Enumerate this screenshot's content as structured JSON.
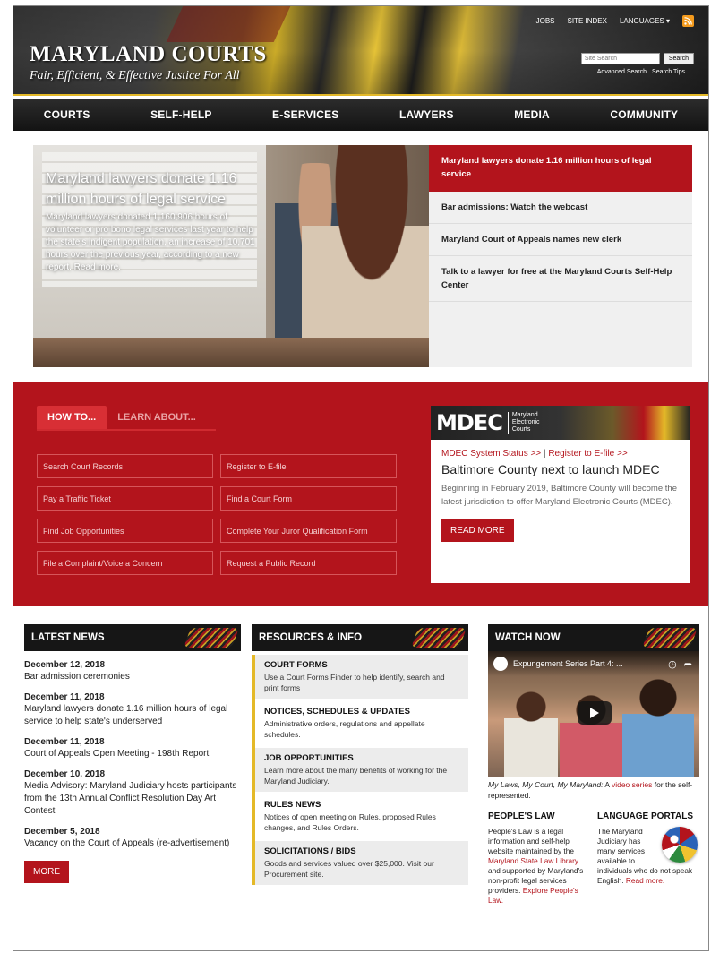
{
  "header": {
    "brand_title": "MARYLAND COURTS",
    "brand_tagline": "Fair, Efficient, & Effective Justice For All",
    "util_links": [
      "JOBS",
      "SITE INDEX",
      "LANGUAGES"
    ],
    "search_placeholder": "Site Search",
    "search_button": "Search",
    "advanced_search": "Advanced Search",
    "search_tips": "Search Tips"
  },
  "nav": [
    "COURTS",
    "SELF-HELP",
    "E-SERVICES",
    "LAWYERS",
    "MEDIA",
    "COMMUNITY"
  ],
  "hero": {
    "title": "Maryland lawyers donate 1.16 million hours of legal service",
    "body": "Maryland lawyers donated 1,160,906 hours of volunteer or pro bono legal services last year to help the state's indigent population, an increase of 10,701 hours over the previous year, according to a new report. Read more.",
    "items": [
      "Maryland lawyers donate 1.16 million hours of legal service",
      "Bar admissions: Watch the webcast",
      "Maryland Court of Appeals names new clerk",
      "Talk to a lawyer for free at the Maryland Courts Self-Help Center"
    ]
  },
  "howto": {
    "tabs": [
      "HOW TO...",
      "LEARN ABOUT..."
    ],
    "links": [
      "Search Court Records",
      "Register to E-file",
      "Pay a Traffic Ticket",
      "Find a Court Form",
      "Find Job Opportunities",
      "Complete Your Juror Qualification Form",
      "File a Complaint/Voice a Concern",
      "Request a Public Record"
    ]
  },
  "mdec": {
    "logo": "MDEC",
    "logo_sub": [
      "Maryland",
      "Electronic",
      "Courts"
    ],
    "status_link": "MDEC System Status >>",
    "separator": "|",
    "efile_link": "Register to E-file >>",
    "headline": "Baltimore County next to launch MDEC",
    "text": "Beginning in February 2019, Baltimore County will become the latest jurisdiction to offer Maryland Electronic Courts (MDEC).",
    "button": "READ MORE"
  },
  "news": {
    "heading": "LATEST NEWS",
    "items": [
      {
        "date": "December 12, 2018",
        "title": "Bar admission ceremonies"
      },
      {
        "date": "December 11, 2018",
        "title": "Maryland lawyers donate 1.16 million hours of legal service to help state's underserved"
      },
      {
        "date": "December 11, 2018",
        "title": "Court of Appeals Open Meeting - 198th Report"
      },
      {
        "date": "December 10, 2018",
        "title": "Media Advisory: Maryland Judiciary hosts participants from the 13th Annual Conflict Resolution Day Art Contest"
      },
      {
        "date": "December 5, 2018",
        "title": "Vacancy on the Court of Appeals (re-advertisement)"
      }
    ],
    "more": "MORE"
  },
  "resources": {
    "heading": "RESOURCES & INFO",
    "items": [
      {
        "title": "COURT FORMS",
        "desc": "Use a Court Forms Finder to help identify, search and print forms"
      },
      {
        "title": "NOTICES, SCHEDULES & UPDATES",
        "desc": "Administrative orders, regulations and appellate schedules."
      },
      {
        "title": "JOB OPPORTUNITIES",
        "desc": "Learn more about the many benefits of working for the Maryland Judiciary."
      },
      {
        "title": "RULES NEWS",
        "desc": "Notices of open meeting on Rules, proposed Rules changes, and Rules Orders."
      },
      {
        "title": "SOLICITATIONS / BIDS",
        "desc": "Goods and services valued over $25,000. Visit our Procurement site."
      }
    ]
  },
  "watch": {
    "heading": "WATCH NOW",
    "video_title": "Expungement Series Part 4: ...",
    "caption_italic": "My Laws, My Court, My Maryland:",
    "caption_a": "A",
    "caption_link": "video series",
    "caption_b": "for the self-represented."
  },
  "peoples_law": {
    "title": "PEOPLE'S LAW",
    "text_a": "People's Law is a legal information and self-help website maintained by the",
    "link": "Maryland State Law Library",
    "text_b": "and supported by Maryland's non-profit legal services providers.",
    "explore": "Explore People's Law."
  },
  "language": {
    "title": "LANGUAGE PORTALS",
    "text": "The Maryland Judiciary has many services available to individuals who do not speak English.",
    "read_more": "Read more."
  },
  "colors": {
    "red": "#b3141c",
    "gold": "#e4b928",
    "dark": "#161616"
  }
}
